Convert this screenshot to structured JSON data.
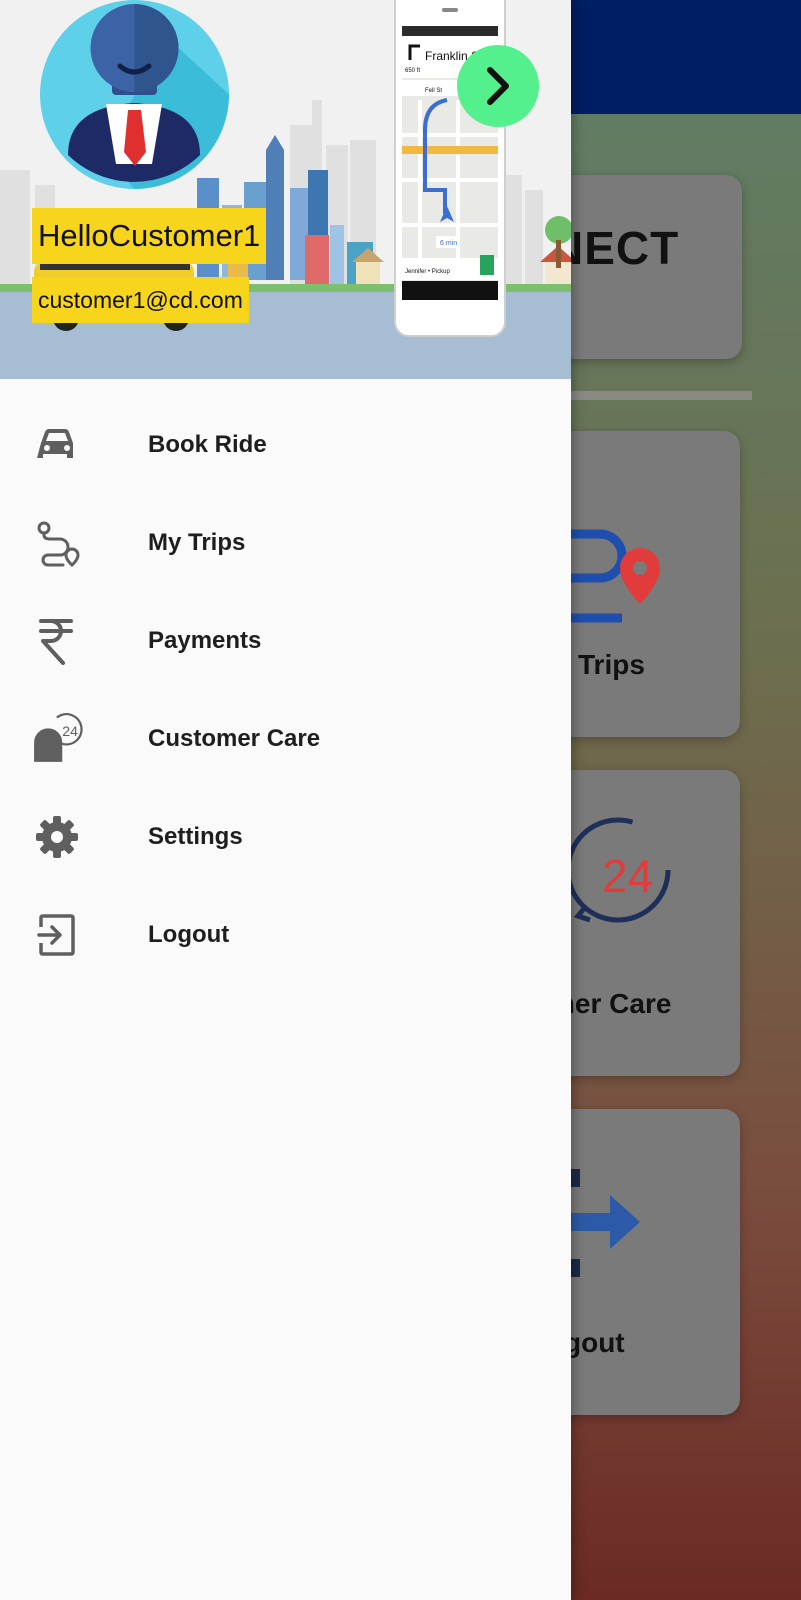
{
  "background": {
    "card_connect_label": "NECT",
    "card_trips_label": "Trips",
    "card_care_label": "mer Care",
    "card_care_badge": "24",
    "card_logout_label": "gout"
  },
  "drawer": {
    "header": {
      "user_name": "HelloCustomer1",
      "user_email": "customer1@cd.com",
      "phone_map": {
        "street": "Franklin S",
        "distance": "650 ft",
        "next_street": "Fell St",
        "eta": "6 min",
        "rider": "Jennifer • Pickup"
      }
    },
    "menu": [
      {
        "label": "Book Ride",
        "icon": "car-icon"
      },
      {
        "label": "My Trips",
        "icon": "route-icon"
      },
      {
        "label": "Payments",
        "icon": "rupee-icon"
      },
      {
        "label": "Customer Care",
        "icon": "customer-care-24-icon",
        "badge": "24"
      },
      {
        "label": "Settings",
        "icon": "gear-icon"
      },
      {
        "label": "Logout",
        "icon": "logout-icon"
      }
    ]
  },
  "colors": {
    "drawer_bg": "#fafafa",
    "name_highlight": "#f7d51c",
    "next_button": "#54f08d",
    "topbar": "#001e63",
    "icon_gray": "#5f5f5f"
  }
}
